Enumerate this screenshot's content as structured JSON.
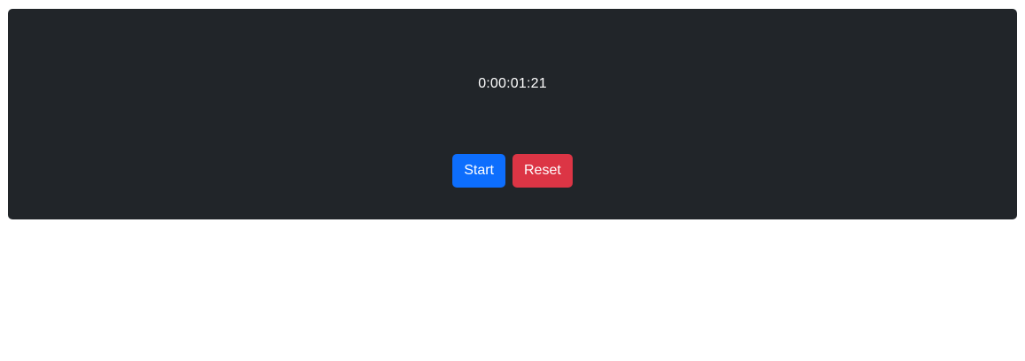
{
  "timer": {
    "display": "0:00:01:21"
  },
  "controls": {
    "start_label": "Start",
    "reset_label": "Reset"
  },
  "colors": {
    "card_background": "#212529",
    "start_button": "#0d6efd",
    "reset_button": "#dc3545",
    "text": "#ffffff"
  }
}
